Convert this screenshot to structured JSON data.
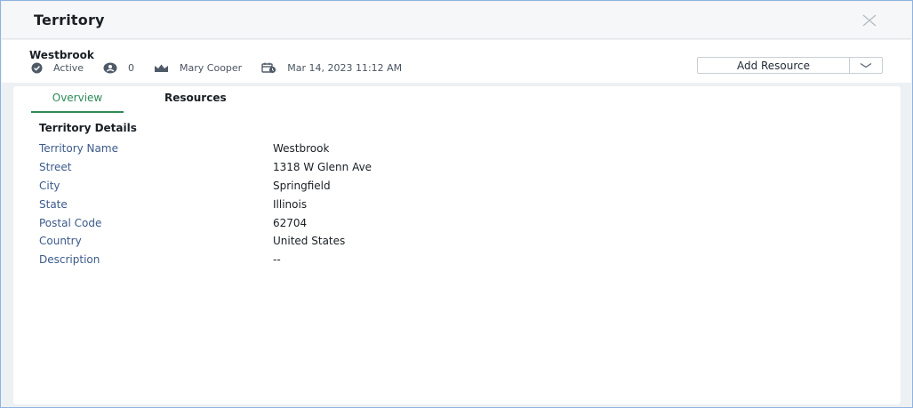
{
  "dialog": {
    "title": "Territory"
  },
  "record": {
    "name": "Westbrook",
    "status": "Active",
    "resource_count": "0",
    "owner": "Mary Cooper",
    "modified": "Mar 14, 2023 11:12 AM"
  },
  "actions": {
    "add_resource_label": "Add Resource"
  },
  "tabs": [
    {
      "label": "Overview",
      "active": true
    },
    {
      "label": "Resources",
      "active": false
    }
  ],
  "details": {
    "section_title": "Territory Details",
    "fields": [
      {
        "label": "Territory Name",
        "value": "Westbrook"
      },
      {
        "label": "Street",
        "value": "1318 W Glenn Ave"
      },
      {
        "label": "City",
        "value": "Springfield"
      },
      {
        "label": "State",
        "value": "Illinois"
      },
      {
        "label": "Postal Code",
        "value": "62704"
      },
      {
        "label": "Country",
        "value": "United States"
      },
      {
        "label": "Description",
        "value": "--"
      }
    ]
  },
  "icons": {
    "close": "close-icon",
    "status": "check-circle-icon",
    "resources": "user-circle-icon",
    "owner": "crown-icon",
    "modified": "calendar-clock-icon",
    "split": "chevron-down-icon"
  },
  "colors": {
    "accent_green": "#2e8b57",
    "label_blue": "#3c5a8a",
    "border_blue": "#8fb4e0"
  }
}
